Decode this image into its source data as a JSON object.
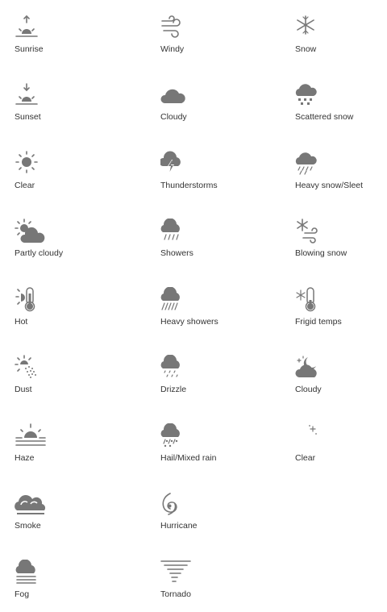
{
  "icons": [
    {
      "label": "Sunrise",
      "icon": "sunrise-icon"
    },
    {
      "label": "Windy",
      "icon": "windy-icon"
    },
    {
      "label": "Snow",
      "icon": "snow-icon"
    },
    {
      "label": "Sunset",
      "icon": "sunset-icon"
    },
    {
      "label": "Cloudy",
      "icon": "cloudy-icon"
    },
    {
      "label": "Scattered snow",
      "icon": "scattered-snow-icon"
    },
    {
      "label": "Clear",
      "icon": "clear-day-icon"
    },
    {
      "label": "Thunderstorms",
      "icon": "thunderstorms-icon"
    },
    {
      "label": "Heavy snow/Sleet",
      "icon": "heavy-snow-sleet-icon"
    },
    {
      "label": "Partly cloudy",
      "icon": "partly-cloudy-icon"
    },
    {
      "label": "Showers",
      "icon": "showers-icon"
    },
    {
      "label": "Blowing snow",
      "icon": "blowing-snow-icon"
    },
    {
      "label": "Hot",
      "icon": "hot-icon"
    },
    {
      "label": "Heavy showers",
      "icon": "heavy-showers-icon"
    },
    {
      "label": "Frigid temps",
      "icon": "frigid-temps-icon"
    },
    {
      "label": "Dust",
      "icon": "dust-icon"
    },
    {
      "label": "Drizzle",
      "icon": "drizzle-icon"
    },
    {
      "label": "Cloudy",
      "icon": "cloudy-night-icon"
    },
    {
      "label": "Haze",
      "icon": "haze-icon"
    },
    {
      "label": "Hail/Mixed rain",
      "icon": "hail-mixed-rain-icon"
    },
    {
      "label": "Clear",
      "icon": "clear-night-icon"
    },
    {
      "label": "Smoke",
      "icon": "smoke-icon"
    },
    {
      "label": "Hurricane",
      "icon": "hurricane-icon"
    },
    {
      "label": "Fog",
      "icon": "fog-icon"
    },
    {
      "label": "Tornado",
      "icon": "tornado-icon"
    }
  ],
  "colors": {
    "icon": "#777777",
    "text": "#333333",
    "background": "#ffffff"
  }
}
